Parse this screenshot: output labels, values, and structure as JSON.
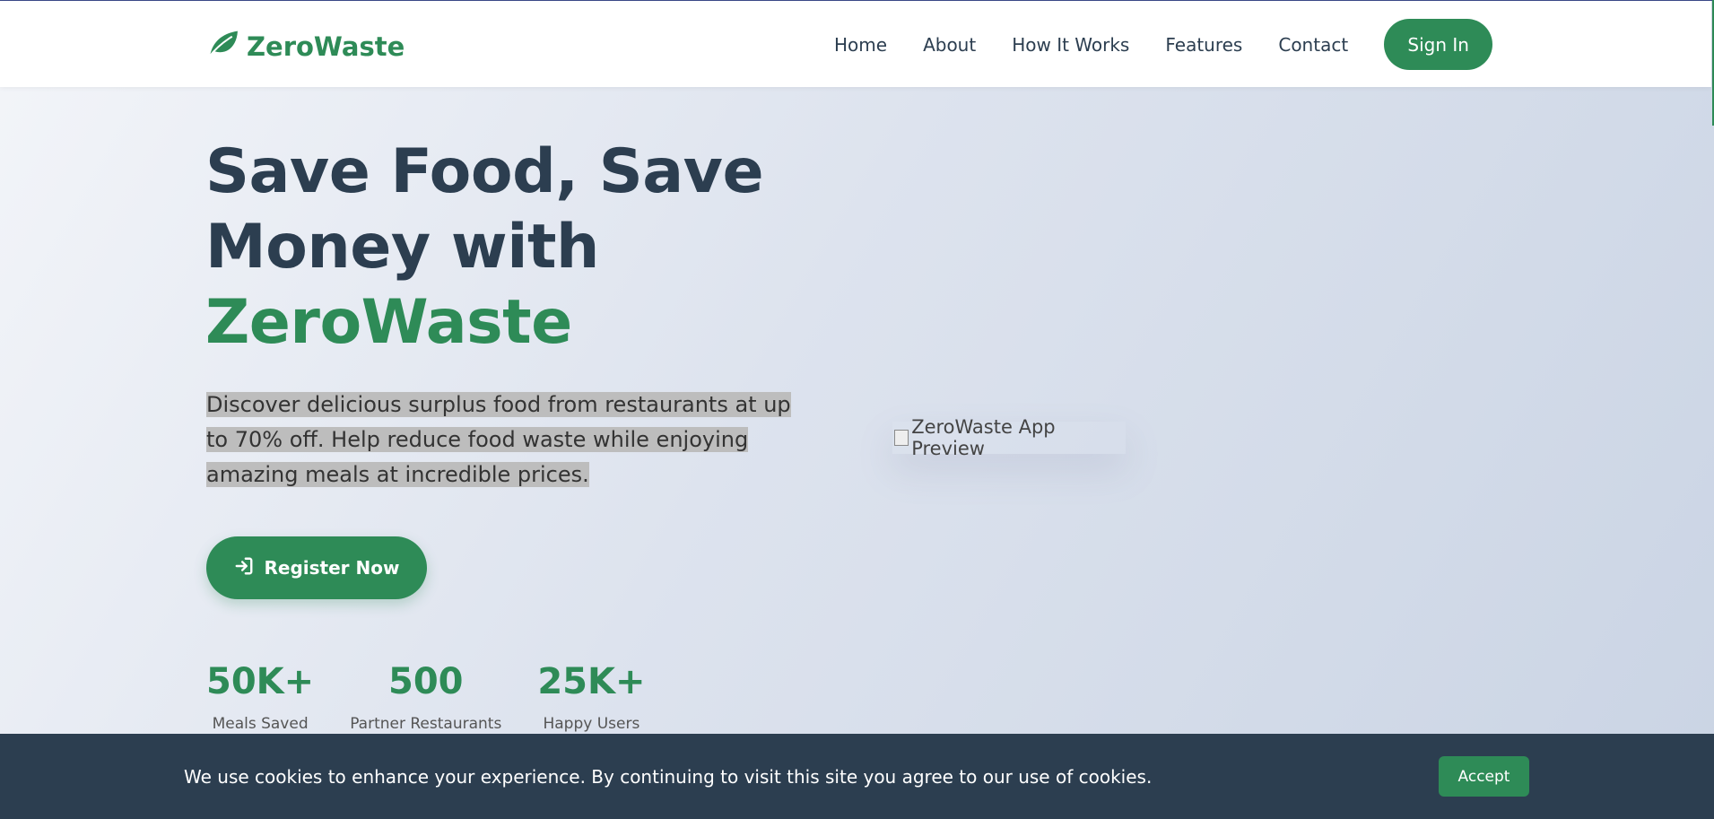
{
  "header": {
    "brand": "ZeroWaste",
    "nav": [
      "Home",
      "About",
      "How It Works",
      "Features",
      "Contact"
    ],
    "signin_label": "Sign In"
  },
  "hero": {
    "title_line1": "Save Food, Save",
    "title_line2": "Money with",
    "title_accent": "ZeroWaste",
    "description": "Discover delicious surplus food from restaurants at up to 70% off. Help reduce food waste while enjoying amazing meals at incredible prices.",
    "register_label": "Register Now",
    "preview_alt": "ZeroWaste App Preview"
  },
  "stats": [
    {
      "value": "50K+",
      "label": "Meals Saved"
    },
    {
      "value": "500",
      "label": "Partner Restaurants"
    },
    {
      "value": "25K+",
      "label": "Happy Users"
    }
  ],
  "cookie": {
    "text": "We use cookies to enhance your experience. By continuing to visit this site you agree to our use of cookies.",
    "accept_label": "Accept"
  },
  "colors": {
    "accent": "#2e8b57",
    "dark": "#2c3e50"
  },
  "icons": {
    "brand": "leaf-icon",
    "register": "sign-in-icon",
    "preview": "broken-image-icon"
  }
}
